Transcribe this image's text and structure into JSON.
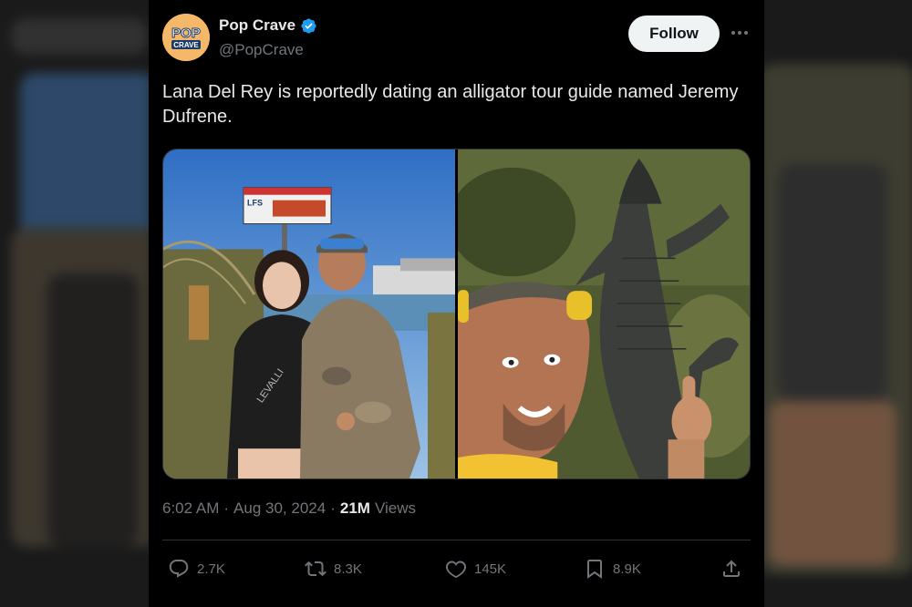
{
  "tweet": {
    "display_name": "Pop Crave",
    "handle": "@PopCrave",
    "avatar_text_top": "POP",
    "avatar_text_bottom": "CRAVE",
    "follow_label": "Follow",
    "text": "Lana Del Rey is reportedly dating an alligator tour guide named Jeremy Dufrene.",
    "time": "6:02 AM",
    "date": "Aug 30, 2024",
    "views_count": "21M",
    "views_label": "Views",
    "billboard_text": "LFS",
    "hoodie_text": "LEVALLI"
  },
  "actions": {
    "replies": "2.7K",
    "reposts": "8.3K",
    "likes": "145K",
    "bookmarks": "8.9K"
  },
  "colors": {
    "background": "#000000",
    "text_primary": "#e7e9ea",
    "text_secondary": "#71767b",
    "verified_blue": "#1d9bf0",
    "follow_bg": "#eff3f4"
  },
  "icons": [
    "verified-icon",
    "more-icon",
    "reply-icon",
    "repost-icon",
    "like-icon",
    "bookmark-icon",
    "share-icon"
  ]
}
